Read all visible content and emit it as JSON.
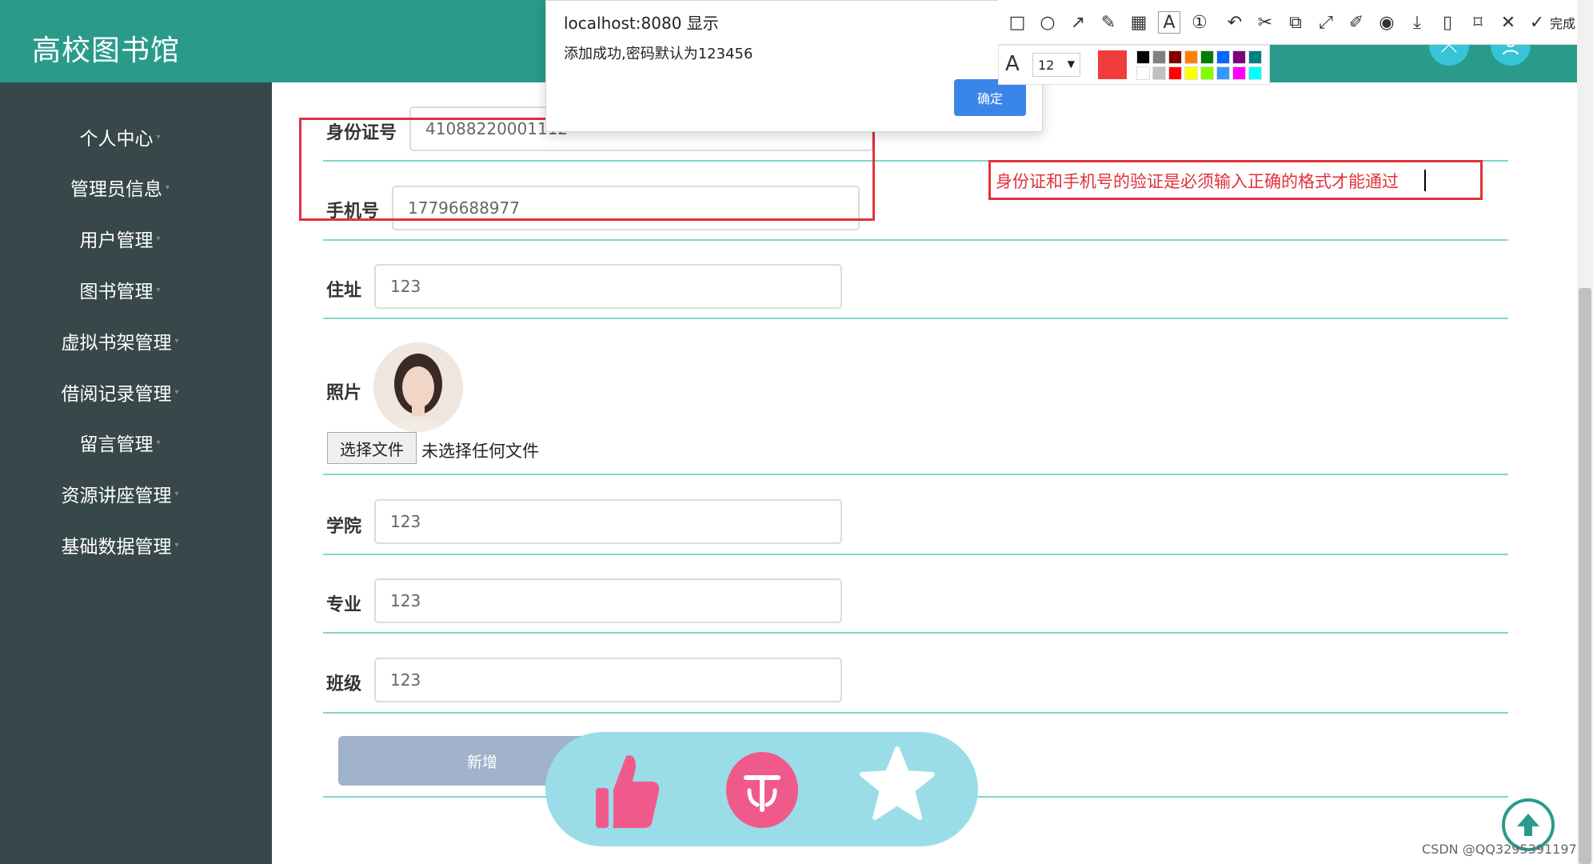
{
  "header": {
    "brand": "高校图书馆"
  },
  "sidebar": {
    "items": [
      {
        "label": "个人中心"
      },
      {
        "label": "管理员信息"
      },
      {
        "label": "用户管理"
      },
      {
        "label": "图书管理"
      },
      {
        "label": "虚拟书架管理"
      },
      {
        "label": "借阅记录管理"
      },
      {
        "label": "留言管理"
      },
      {
        "label": "资源讲座管理"
      },
      {
        "label": "基础数据管理"
      }
    ]
  },
  "form": {
    "id_card": {
      "label": "身份证号",
      "value": "41088220001112"
    },
    "phone": {
      "label": "手机号",
      "value": "17796688977"
    },
    "address": {
      "label": "住址",
      "value": "123"
    },
    "photo": {
      "label": "照片",
      "file_button": "选择文件",
      "file_status": "未选择任何文件"
    },
    "college": {
      "label": "学院",
      "value": "123"
    },
    "major": {
      "label": "专业",
      "value": "123"
    },
    "class": {
      "label": "班级",
      "value": "123"
    },
    "submit_label": "新增"
  },
  "annotation": {
    "text": "身份证和手机号的验证是必须输入正确的格式才能通过"
  },
  "dialog": {
    "title": "localhost:8080 显示",
    "message": "添加成功,密码默认为123456",
    "ok_label": "确定"
  },
  "toolbar": {
    "done_label": "完成",
    "font_size": "12",
    "current_color": "#f03c3c",
    "palette": [
      "#000000",
      "#808080",
      "#800000",
      "#ff8000",
      "#008000",
      "#0066ff",
      "#800080",
      "#008080",
      "#ffffff",
      "#c0c0c0",
      "#ff0000",
      "#ffff00",
      "#80ff00",
      "#3399ff",
      "#ff00ff",
      "#00ffff"
    ]
  },
  "watermark": "CSDN @QQ3295391197",
  "colors": {
    "theme": "#2a9b8a",
    "sidebar": "#37474a",
    "annotation": "#e0323a",
    "button_blue": "#3a86e8"
  }
}
